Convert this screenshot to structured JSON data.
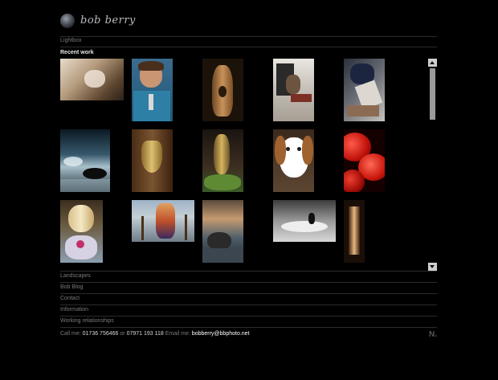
{
  "logo": {
    "text": "bob berry"
  },
  "nav_top": {
    "lightbox": "Lightbox",
    "recent_work": "Recent work"
  },
  "gallery": {
    "thumbnails": [
      {
        "subject": "baby-reading"
      },
      {
        "subject": "boy-portrait"
      },
      {
        "subject": "wooden-sculpture"
      },
      {
        "subject": "man-in-doorway"
      },
      {
        "subject": "blue-sculpture"
      },
      {
        "subject": "waves-on-rocks"
      },
      {
        "subject": "brass-door-hand"
      },
      {
        "subject": "brass-sculpture-salad"
      },
      {
        "subject": "beagle"
      },
      {
        "subject": "red-tomatoes"
      },
      {
        "subject": "venice-mask"
      },
      {
        "subject": "carnival-figure-venice"
      },
      {
        "subject": "rocks-at-sunset"
      },
      {
        "subject": "wave-rider"
      },
      {
        "subject": "doorway-light"
      }
    ]
  },
  "nav_bottom": [
    {
      "label": "Landscapes"
    },
    {
      "label": "Bob Blog"
    },
    {
      "label": "Contact"
    },
    {
      "label": "Information"
    },
    {
      "label": "Working relationships"
    }
  ],
  "footer": {
    "call_label": "Call me:",
    "phone1": "01736 756466",
    "or": "or",
    "phone2": "07971 193 118",
    "email_label": "Email me:",
    "email": "bobberry@bbphoto.net"
  },
  "corner_mark": "N."
}
